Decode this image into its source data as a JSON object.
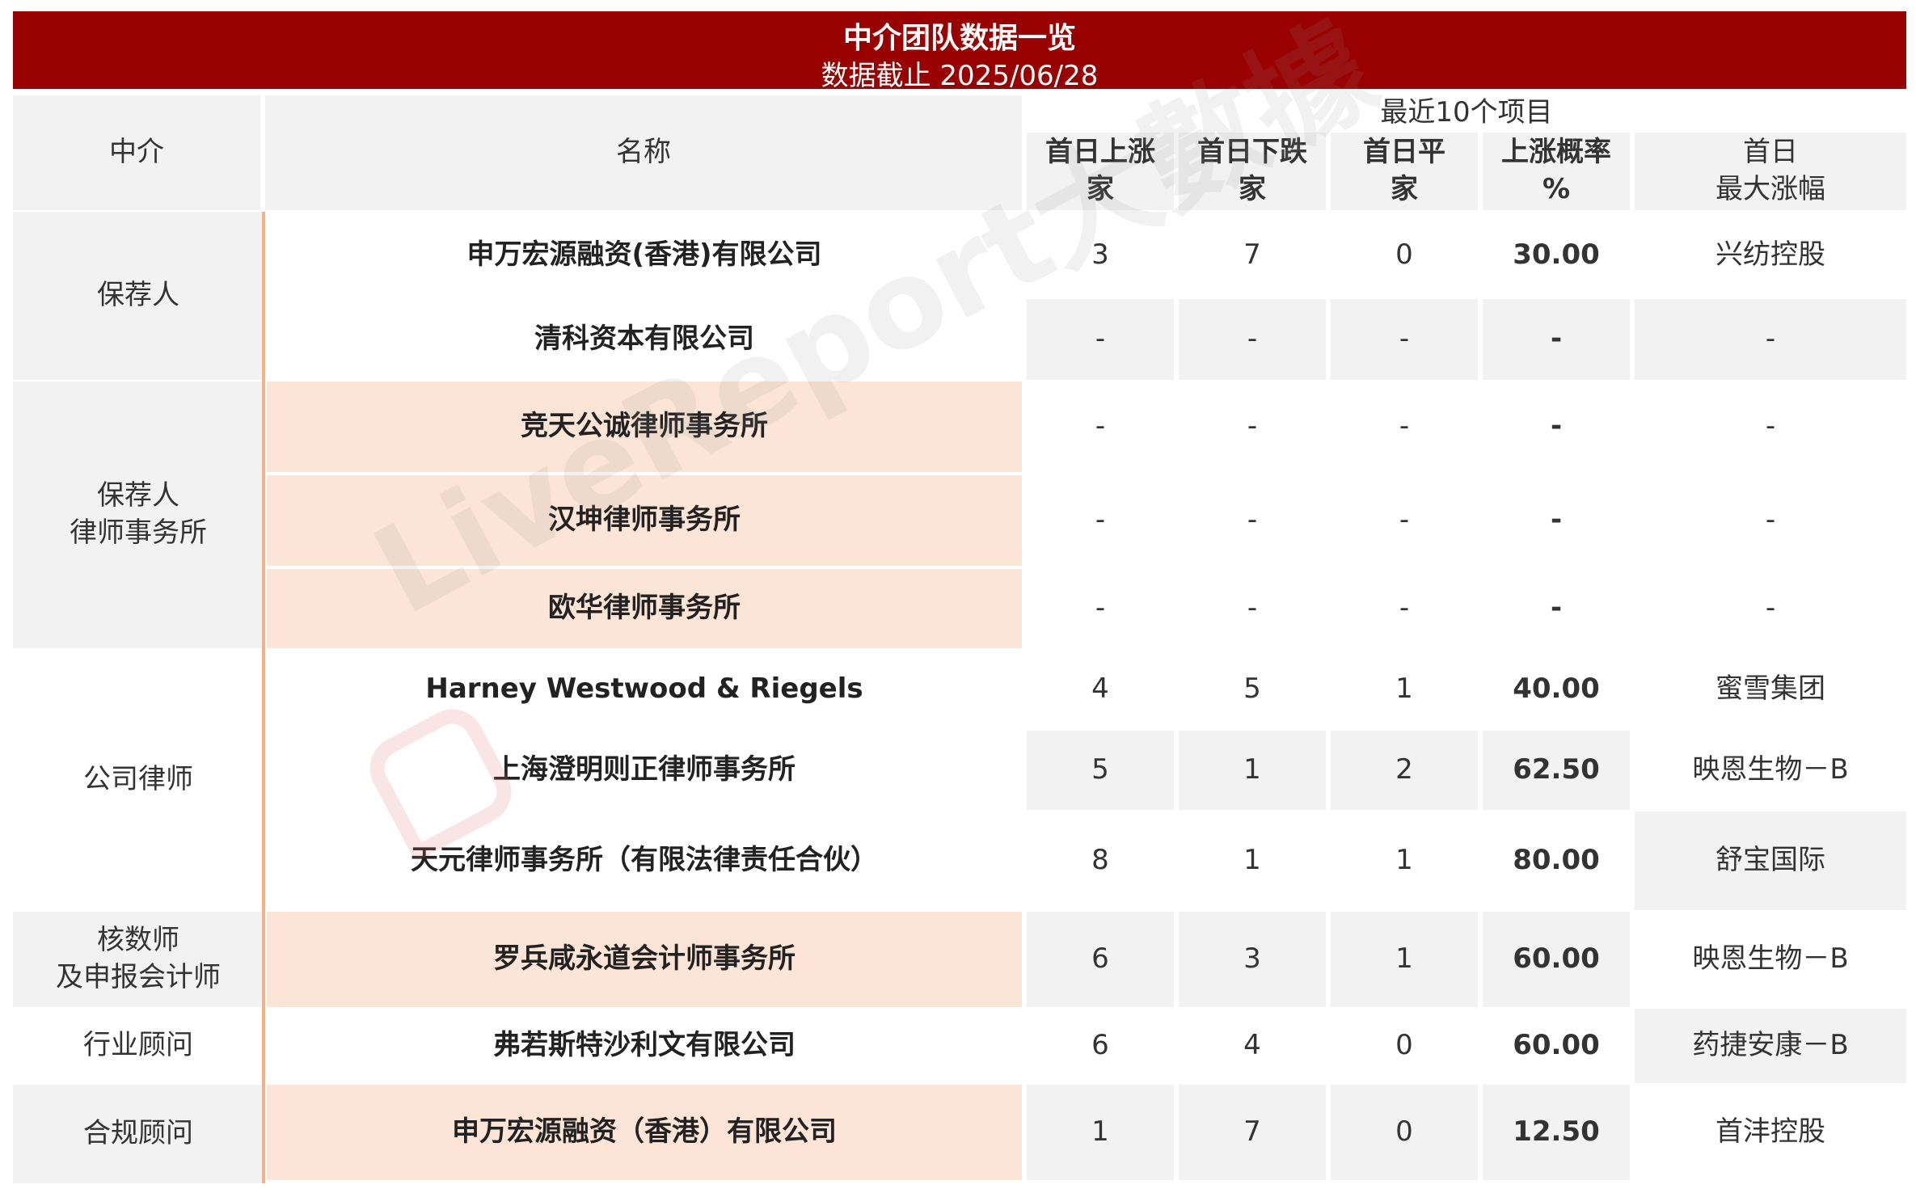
{
  "banner": {
    "title": "中介团队数据一览",
    "subtitle": "数据截止 2025/06/28"
  },
  "header": {
    "col_agency": "中介",
    "col_name": "名称",
    "group_label": "最近10个项目",
    "col_up": "首日上涨\n家",
    "col_down": "首日下跌\n家",
    "col_flat": "首日平\n家",
    "col_rate": "上涨概率\n%",
    "col_max": "首日\n最大涨幅"
  },
  "groups": [
    {
      "label": "保荐人"
    },
    {
      "label": "保荐人\n律师事务所"
    },
    {
      "label": "公司律师"
    },
    {
      "label": "核数师\n及申报会计师"
    },
    {
      "label": "行业顾问"
    },
    {
      "label": "合规顾问"
    }
  ],
  "rows": [
    {
      "name": "申万宏源融资(香港)有限公司",
      "up": "3",
      "down": "7",
      "flat": "0",
      "rate": "30.00",
      "max": "兴纺控股"
    },
    {
      "name": "清科资本有限公司",
      "up": "-",
      "down": "-",
      "flat": "-",
      "rate": "-",
      "max": "-"
    },
    {
      "name": "竞天公诚律师事务所",
      "up": "-",
      "down": "-",
      "flat": "-",
      "rate": "-",
      "max": "-"
    },
    {
      "name": "汉坤律师事务所",
      "up": "-",
      "down": "-",
      "flat": "-",
      "rate": "-",
      "max": "-"
    },
    {
      "name": "欧华律师事务所",
      "up": "-",
      "down": "-",
      "flat": "-",
      "rate": "-",
      "max": "-"
    },
    {
      "name": "Harney Westwood & Riegels",
      "up": "4",
      "down": "5",
      "flat": "1",
      "rate": "40.00",
      "max": "蜜雪集团"
    },
    {
      "name": "上海澄明则正律师事务所",
      "up": "5",
      "down": "1",
      "flat": "2",
      "rate": "62.50",
      "max": "映恩生物－B"
    },
    {
      "name": "天元律师事务所（有限法律责任合伙）",
      "up": "8",
      "down": "1",
      "flat": "1",
      "rate": "80.00",
      "max": "舒宝国际"
    },
    {
      "name": "罗兵咸永道会计师事务所",
      "up": "6",
      "down": "3",
      "flat": "1",
      "rate": "60.00",
      "max": "映恩生物－B"
    },
    {
      "name": "弗若斯特沙利文有限公司",
      "up": "6",
      "down": "4",
      "flat": "0",
      "rate": "60.00",
      "max": "药捷安康－B"
    },
    {
      "name": "申万宏源融资（香港）有限公司",
      "up": "1",
      "down": "7",
      "flat": "0",
      "rate": "12.50",
      "max": "首沣控股"
    }
  ],
  "watermark": "LiveReport大數據",
  "colors": {
    "banner": "#990000",
    "peach": "#fce4d6",
    "grey": "#f2f2f2",
    "divider": "#f4b183"
  }
}
